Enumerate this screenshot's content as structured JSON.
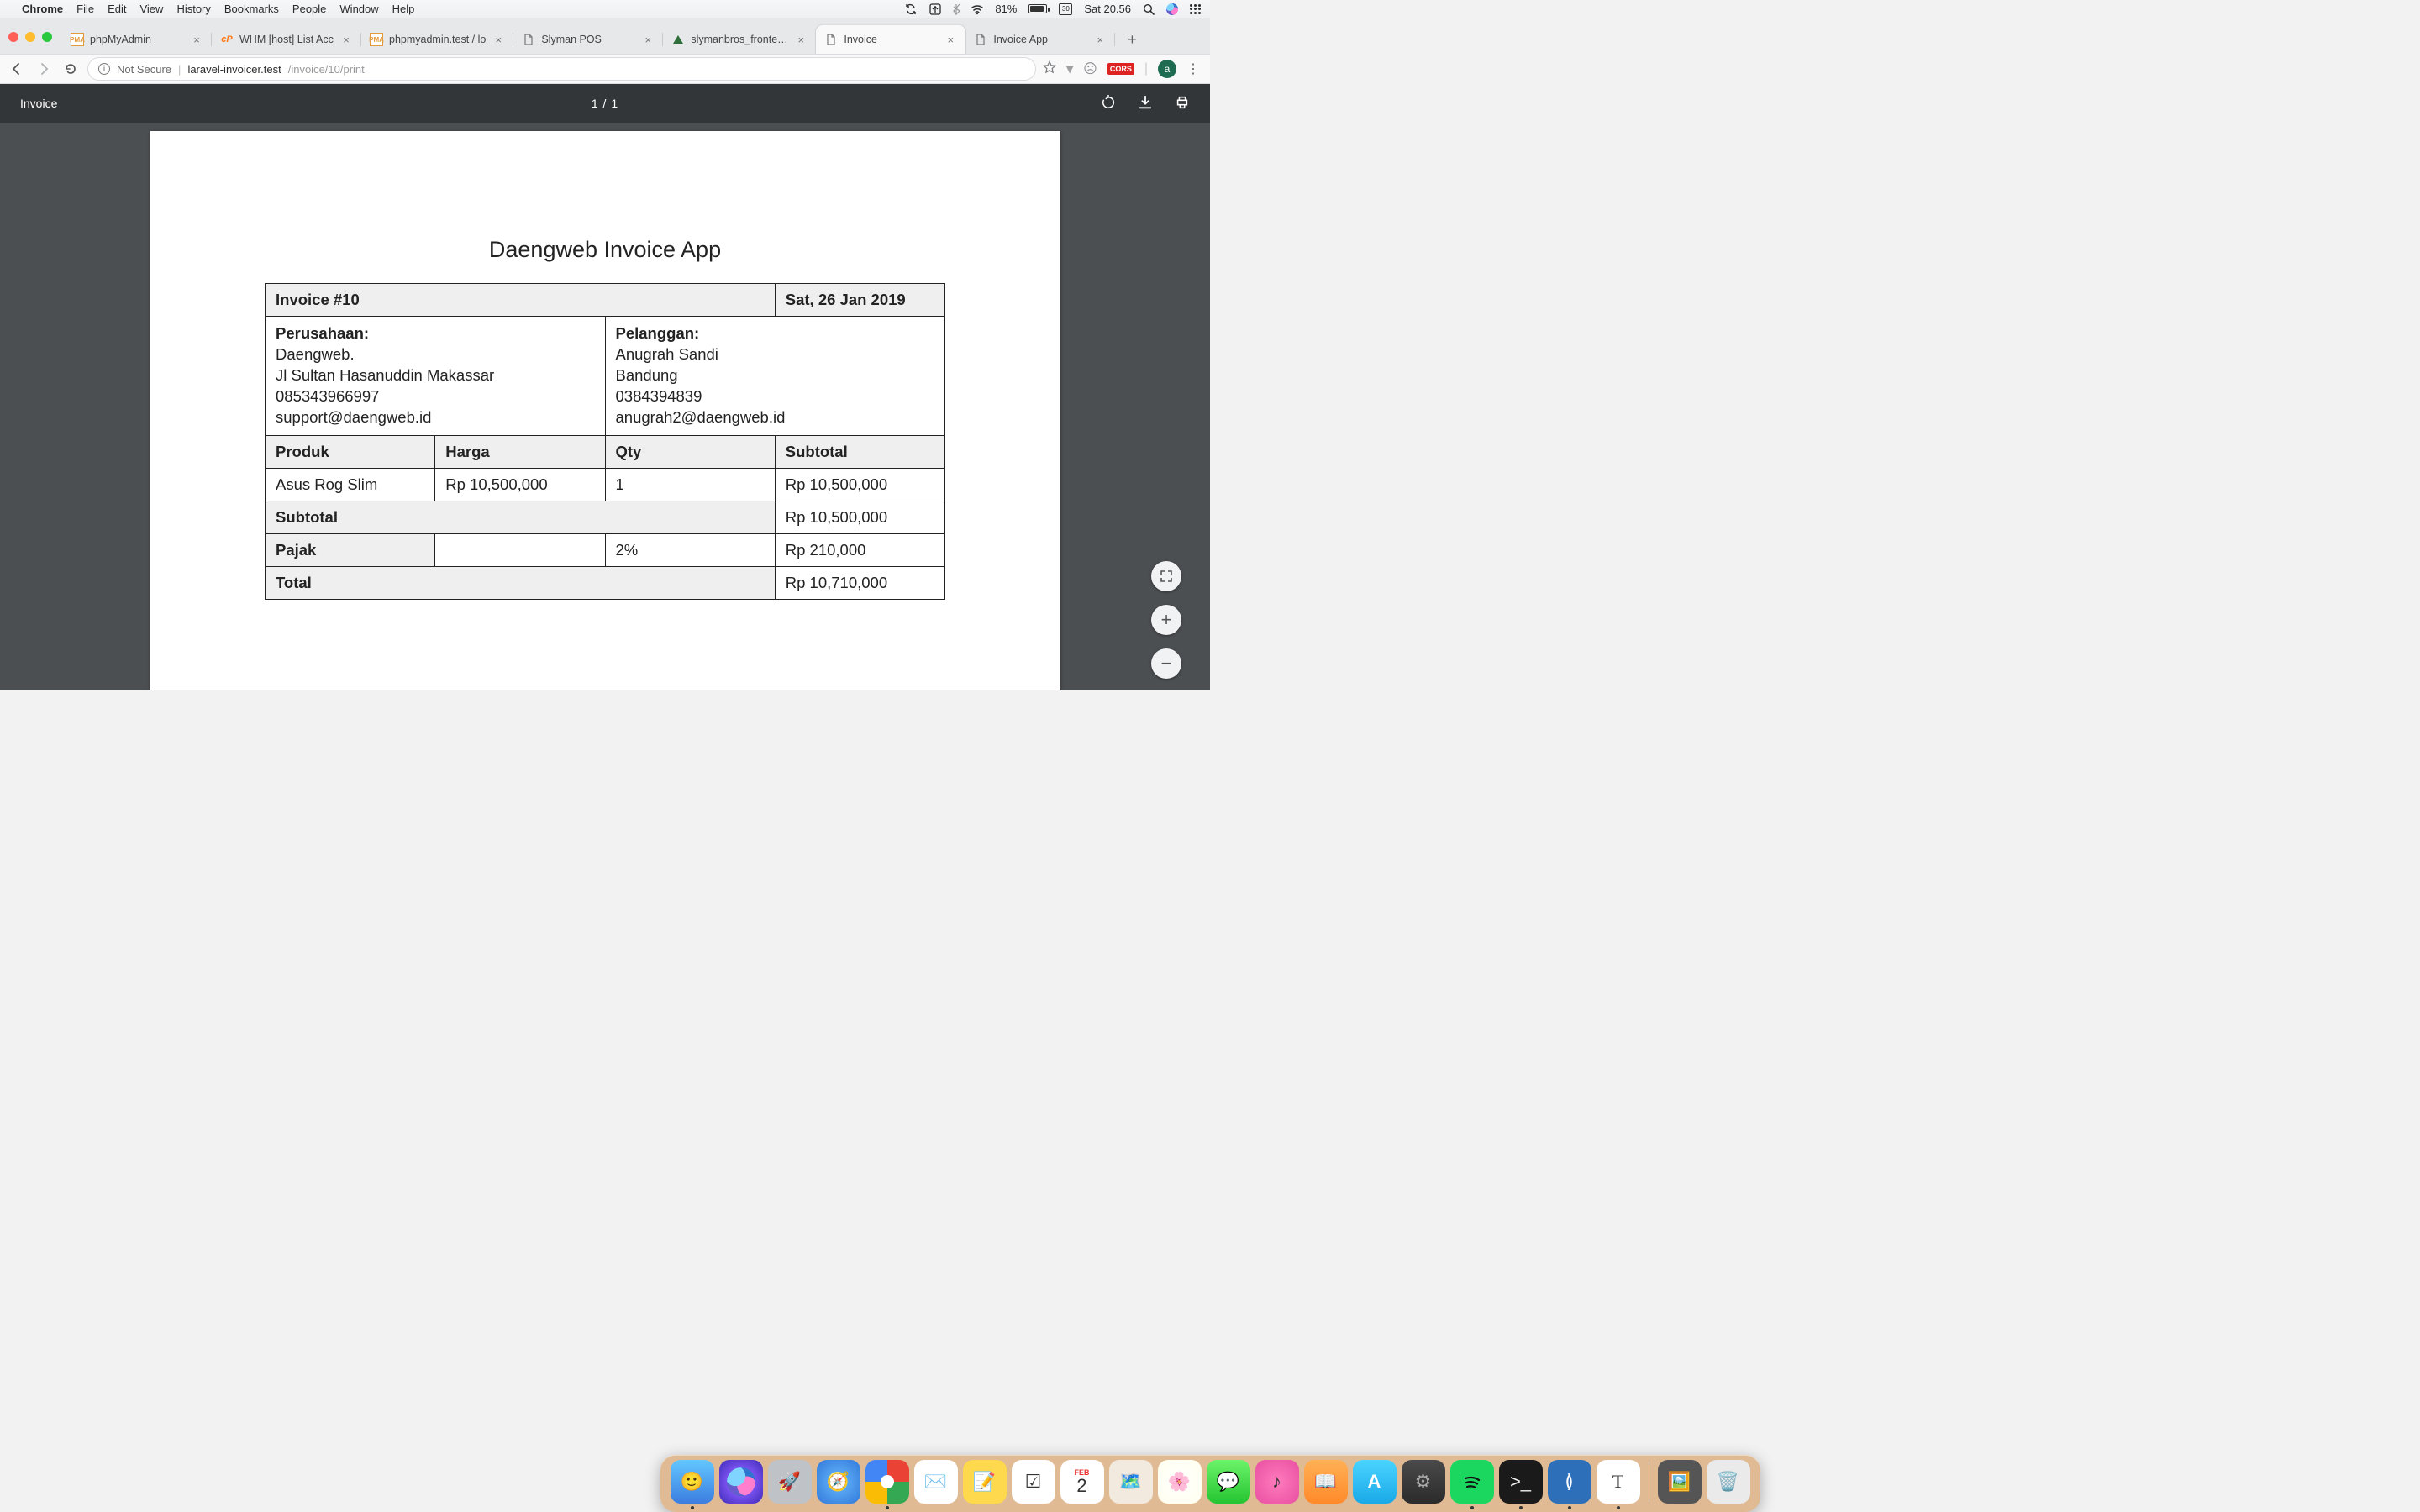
{
  "menubar": {
    "app": "Chrome",
    "items": [
      "File",
      "Edit",
      "View",
      "History",
      "Bookmarks",
      "People",
      "Window",
      "Help"
    ],
    "battery": "81%",
    "date_badge": "30",
    "clock": "Sat 20.56"
  },
  "tabs": [
    {
      "title": "phpMyAdmin",
      "fav": "pma"
    },
    {
      "title": "WHM [host] List Acc",
      "fav": "cp"
    },
    {
      "title": "phpmyadmin.test / lo",
      "fav": "pma"
    },
    {
      "title": "Slyman POS",
      "fav": "file"
    },
    {
      "title": "slymanbros_frontend",
      "fav": "tri"
    },
    {
      "title": "Invoice",
      "fav": "file",
      "active": true
    },
    {
      "title": "Invoice App",
      "fav": "file"
    }
  ],
  "address": {
    "not_secure": "Not Secure",
    "host": "laravel-invoicer.test",
    "path": "/invoice/10/print"
  },
  "extensions": {
    "cors": "CORS",
    "avatar": "a"
  },
  "pdfbar": {
    "title": "Invoice",
    "pages": "1  /  1"
  },
  "invoice": {
    "heading": "Daengweb Invoice App",
    "number_label": "Invoice #10",
    "date": "Sat, 26 Jan 2019",
    "company": {
      "label": "Perusahaan:",
      "name": "Daengweb.",
      "address": "Jl Sultan Hasanuddin Makassar",
      "phone": "085343966997",
      "email": "support@daengweb.id"
    },
    "customer": {
      "label": "Pelanggan:",
      "name": "Anugrah Sandi",
      "address": "Bandung",
      "phone": "0384394839",
      "email": "anugrah2@daengweb.id"
    },
    "cols": {
      "product": "Produk",
      "price": "Harga",
      "qty": "Qty",
      "subtotal": "Subtotal"
    },
    "items": [
      {
        "product": "Asus Rog Slim",
        "price": "Rp 10,500,000",
        "qty": "1",
        "subtotal": "Rp 10,500,000"
      }
    ],
    "subtotal_label": "Subtotal",
    "subtotal": "Rp 10,500,000",
    "tax_label": "Pajak",
    "tax_rate": "2%",
    "tax": "Rp 210,000",
    "total_label": "Total",
    "total": "Rp 10,710,000"
  },
  "dock": {
    "cal_month": "FEB",
    "cal_day": "2",
    "text_icon": "T"
  }
}
